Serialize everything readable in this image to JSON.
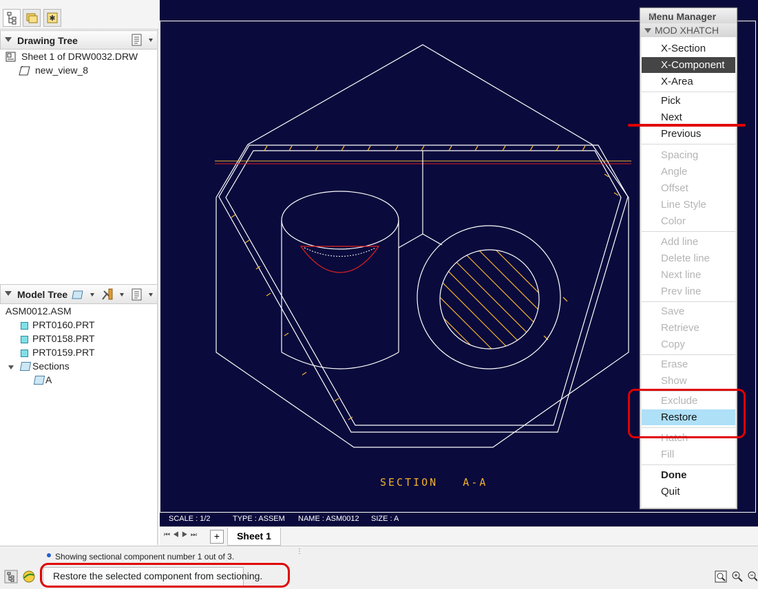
{
  "drawing_tree": {
    "title": "Drawing Tree",
    "items": [
      {
        "label": "Sheet 1 of DRW0032.DRW"
      },
      {
        "label": "new_view_8"
      }
    ]
  },
  "model_tree": {
    "title": "Model Tree",
    "root": "ASM0012.ASM",
    "parts": [
      "PRT0160.PRT",
      "PRT0158.PRT",
      "PRT0159.PRT"
    ],
    "sections_label": "Sections",
    "section_item": "A"
  },
  "drawing": {
    "section_label": "SECTION   A-A",
    "info": {
      "scale": "SCALE : 1/2",
      "type": "TYPE : ASSEM",
      "name": "NAME : ASM0012",
      "size": "SIZE : A"
    }
  },
  "menu_manager": {
    "title": "Menu Manager",
    "close": "×",
    "submenu": "MOD XHATCH",
    "groups": [
      [
        {
          "label": "X-Section",
          "state": "normal"
        },
        {
          "label": "X-Component",
          "state": "selected"
        },
        {
          "label": "X-Area",
          "state": "normal"
        }
      ],
      [
        {
          "label": "Pick",
          "state": "normal"
        },
        {
          "label": "Next",
          "state": "normal"
        },
        {
          "label": "Previous",
          "state": "normal"
        }
      ],
      [
        {
          "label": "Spacing",
          "state": "disabled"
        },
        {
          "label": "Angle",
          "state": "disabled"
        },
        {
          "label": "Offset",
          "state": "disabled"
        },
        {
          "label": "Line Style",
          "state": "disabled"
        },
        {
          "label": "Color",
          "state": "disabled"
        }
      ],
      [
        {
          "label": "Add line",
          "state": "disabled"
        },
        {
          "label": "Delete line",
          "state": "disabled"
        },
        {
          "label": "Next line",
          "state": "disabled"
        },
        {
          "label": "Prev line",
          "state": "disabled"
        }
      ],
      [
        {
          "label": "Save",
          "state": "disabled"
        },
        {
          "label": "Retrieve",
          "state": "disabled"
        },
        {
          "label": "Copy",
          "state": "disabled"
        }
      ],
      [
        {
          "label": "Erase",
          "state": "disabled"
        },
        {
          "label": "Show",
          "state": "disabled"
        }
      ],
      [
        {
          "label": "Exclude",
          "state": "disabled"
        },
        {
          "label": "Restore",
          "state": "highlighted"
        }
      ],
      [
        {
          "label": "Hatch",
          "state": "disabled"
        },
        {
          "label": "Fill",
          "state": "disabled"
        }
      ],
      [
        {
          "label": "Done",
          "state": "bold"
        },
        {
          "label": "Quit",
          "state": "normal"
        }
      ]
    ]
  },
  "sheet_tabs": {
    "add": "+",
    "active": "Sheet 1"
  },
  "status": {
    "message": "Showing sectional component number 1 out of 3.",
    "prompt": "Restore the selected component from sectioning."
  },
  "colors": {
    "canvas_bg": "#0a0a3c",
    "geometry": "#ffffff",
    "hatch": "#f0b030",
    "cut_curve": "#e02020",
    "annotation": "#e00000"
  }
}
